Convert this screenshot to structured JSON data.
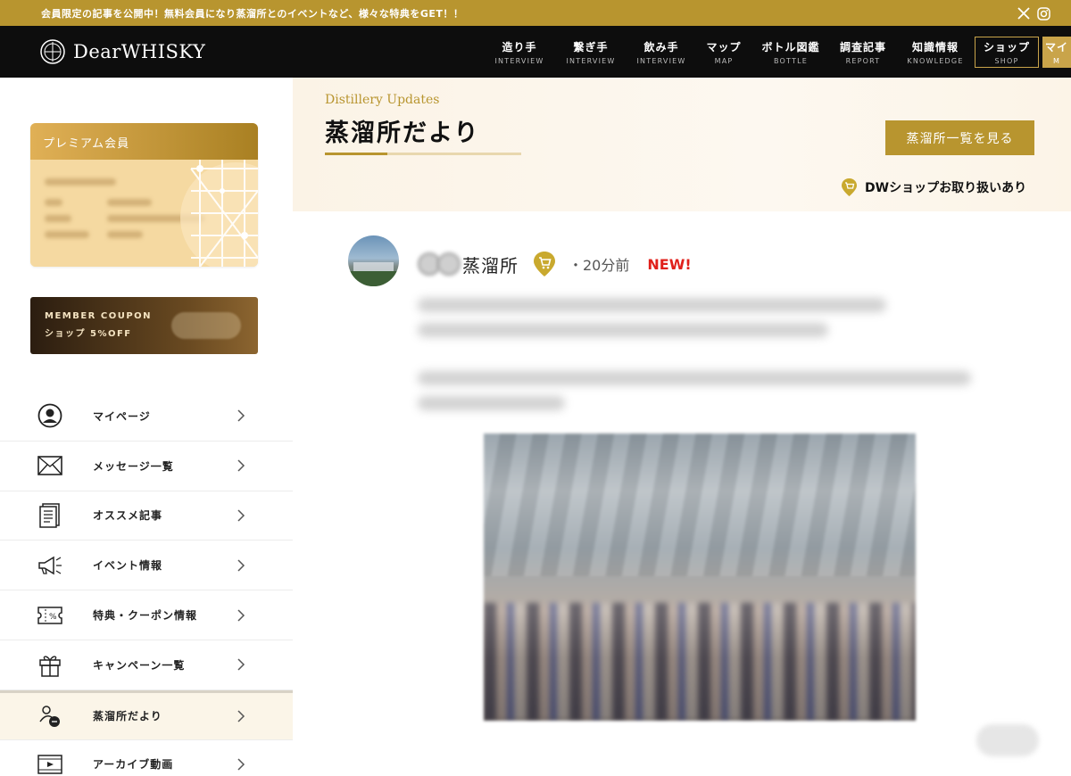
{
  "topbar": {
    "message": "会員限定の記事を公開中！無料会員になり蒸溜所とのイベントなど、様々な特典をGET！！"
  },
  "header": {
    "logo_text": "DearWHISKY",
    "nav": [
      {
        "jp": "造り手",
        "en": "INTERVIEW"
      },
      {
        "jp": "繋ぎ手",
        "en": "INTERVIEW"
      },
      {
        "jp": "飲み手",
        "en": "INTERVIEW"
      },
      {
        "jp": "マップ",
        "en": "MAP"
      },
      {
        "jp": "ボトル図鑑",
        "en": "BOTTLE"
      },
      {
        "jp": "調査記事",
        "en": "REPORT"
      },
      {
        "jp": "知識情報",
        "en": "KNOWLEDGE"
      },
      {
        "jp": "ショップ",
        "en": "SHOP"
      },
      {
        "jp": "マイ",
        "en": "M"
      }
    ]
  },
  "sidebar": {
    "member_card_title": "プレミアム会員",
    "coupon_line1": "MEMBER COUPON",
    "coupon_line2": "ショップ 5%OFF",
    "menu": [
      {
        "label": "マイページ",
        "icon": "user-icon"
      },
      {
        "label": "メッセージ一覧",
        "icon": "mail-icon"
      },
      {
        "label": "オススメ記事",
        "icon": "article-icon"
      },
      {
        "label": "イベント情報",
        "icon": "megaphone-icon"
      },
      {
        "label": "特典・クーポン情報",
        "icon": "coupon-icon"
      },
      {
        "label": "キャンペーン一覧",
        "icon": "gift-icon"
      },
      {
        "label": "蒸溜所だより",
        "icon": "people-chat-icon",
        "active": true
      },
      {
        "label": "アーカイブ動画",
        "icon": "video-icon"
      }
    ]
  },
  "main": {
    "subtitle": "Distillery Updates",
    "title": "蒸溜所だより",
    "list_button": "蒸溜所一覧を見る",
    "shop_note": "DWショップお取り扱いあり",
    "post": {
      "name": "蒸溜所",
      "time": "・20分前",
      "new_label": "NEW!"
    }
  },
  "colors": {
    "gold": "#b8952f",
    "header_bg": "#0d0d0d",
    "new_red": "#e0201b"
  }
}
